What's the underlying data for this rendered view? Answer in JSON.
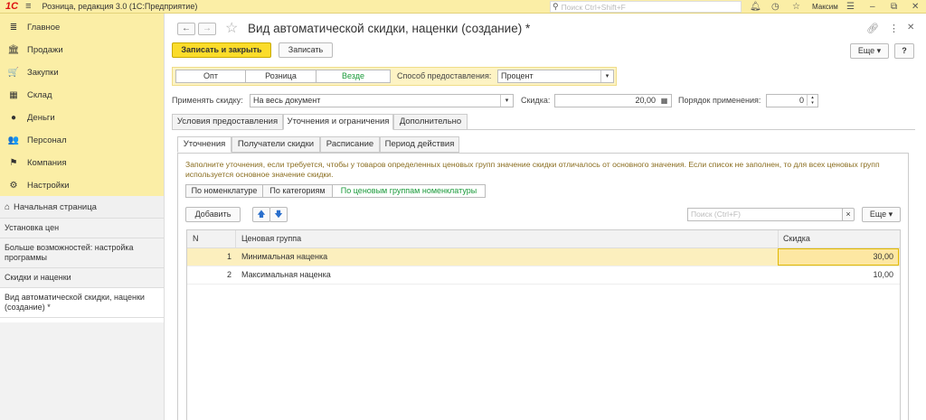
{
  "topbar": {
    "logo": "1С",
    "app_title": "Розница, редакция 3.0  (1С:Предприятие)",
    "search_placeholder": "Поиск Ctrl+Shift+F",
    "user": "Максим"
  },
  "sidebar": {
    "items": [
      {
        "label": "Главное",
        "icon": "≣"
      },
      {
        "label": "Продажи",
        "icon": "🏛"
      },
      {
        "label": "Закупки",
        "icon": "🛒"
      },
      {
        "label": "Склад",
        "icon": "▦"
      },
      {
        "label": "Деньги",
        "icon": "●"
      },
      {
        "label": "Персонал",
        "icon": "👥"
      },
      {
        "label": "Компания",
        "icon": "⚑"
      },
      {
        "label": "Настройки",
        "icon": "⚙"
      }
    ],
    "home_label": "Начальная страница",
    "open_windows": [
      "Установка цен",
      "Больше возможностей: настройка программы",
      "Скидки и наценки",
      "Вид автоматической скидки, наценки (создание) *"
    ]
  },
  "form": {
    "title": "Вид автоматической скидки, наценки (создание) *",
    "save_close": "Записать и закрыть",
    "save": "Записать",
    "more": "Еще",
    "help": "?",
    "channels": [
      "Опт",
      "Розница",
      "Везде"
    ],
    "method_label": "Способ предоставления:",
    "method_value": "Процент",
    "apply_label": "Применять скидку:",
    "apply_value": "На весь документ",
    "discount_label": "Скидка:",
    "discount_value": "20,00",
    "order_label": "Порядок применения:",
    "order_value": "0",
    "tabs": [
      "Условия предоставления",
      "Уточнения и ограничения",
      "Дополнительно"
    ],
    "subtabs": [
      "Уточнения",
      "Получатели скидки",
      "Расписание",
      "Период действия"
    ],
    "info": "Заполните уточнения, если требуется, чтобы у товаров определенных ценовых групп значение скидки отличалось от основного значения. Если список не заполнен, то для всех ценовых групп используется основное значение скидки.",
    "modes": [
      "По номенклатуре",
      "По категориям",
      "По ценовым группам номенклатуры"
    ],
    "add": "Добавить",
    "table_search_placeholder": "Поиск (Ctrl+F)",
    "clear": "×",
    "table": {
      "headers": [
        "N",
        "Ценовая группа",
        "Скидка"
      ],
      "rows": [
        {
          "n": "1",
          "group": "Минимальная наценка",
          "discount": "30,00"
        },
        {
          "n": "2",
          "group": "Максимальная наценка",
          "discount": "10,00"
        }
      ]
    }
  }
}
